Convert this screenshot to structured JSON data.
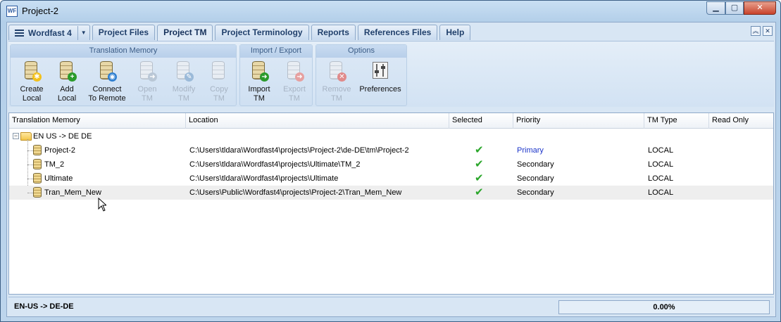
{
  "window": {
    "title": "Project-2",
    "app_icon": "WF"
  },
  "window_controls": {
    "minimize": "▁",
    "maximize": "▢",
    "close": "✕"
  },
  "tabs": [
    {
      "label": "Wordfast 4"
    },
    {
      "label": "Project Files"
    },
    {
      "label": "Project TM"
    },
    {
      "label": "Project Terminology"
    },
    {
      "label": "Reports"
    },
    {
      "label": "References Files"
    },
    {
      "label": "Help"
    }
  ],
  "active_tab": "Project TM",
  "ribbon": {
    "groups": [
      {
        "title": "Translation Memory",
        "buttons": [
          {
            "line1": "Create",
            "line2": "Local",
            "icon": "db-create-icon",
            "enabled": true
          },
          {
            "line1": "Add",
            "line2": "Local",
            "icon": "db-add-icon",
            "enabled": true
          },
          {
            "line1": "Connect",
            "line2": "To Remote",
            "icon": "db-connect-icon",
            "enabled": true
          },
          {
            "line1": "Open",
            "line2": "TM",
            "icon": "db-open-icon",
            "enabled": false
          },
          {
            "line1": "Modify",
            "line2": "TM",
            "icon": "db-modify-icon",
            "enabled": false
          },
          {
            "line1": "Copy",
            "line2": "TM",
            "icon": "db-copy-icon",
            "enabled": false
          }
        ]
      },
      {
        "title": "Import / Export",
        "buttons": [
          {
            "line1": "Import",
            "line2": "TM",
            "icon": "import-icon",
            "enabled": true
          },
          {
            "line1": "Export",
            "line2": "TM",
            "icon": "export-icon",
            "enabled": false
          }
        ]
      },
      {
        "title": "Options",
        "buttons": [
          {
            "line1": "Remove",
            "line2": "TM",
            "icon": "db-remove-icon",
            "enabled": false
          },
          {
            "line1": "Preferences",
            "line2": "",
            "icon": "preferences-icon",
            "enabled": true
          }
        ]
      }
    ]
  },
  "table": {
    "columns": [
      "Translation Memory",
      "Location",
      "Selected",
      "Priority",
      "TM Type",
      "Read Only"
    ],
    "group_label": "EN US -> DE DE",
    "rows": [
      {
        "name": "Project-2",
        "location": "C:\\Users\\tldara\\Wordfast4\\projects\\Project-2\\de-DE\\tm\\Project-2",
        "selected": true,
        "priority": "Primary",
        "type": "LOCAL",
        "read_only": ""
      },
      {
        "name": "TM_2",
        "location": "C:\\Users\\tldara\\Wordfast4\\projects\\Ultimate\\TM_2",
        "selected": true,
        "priority": "Secondary",
        "type": "LOCAL",
        "read_only": ""
      },
      {
        "name": "Ultimate",
        "location": "C:\\Users\\tldara\\Wordfast4\\projects\\Ultimate",
        "selected": true,
        "priority": "Secondary",
        "type": "LOCAL",
        "read_only": ""
      },
      {
        "name": "Tran_Mem_New",
        "location": "C:\\Users\\Public\\Wordfast4\\projects\\Project-2\\Tran_Mem_New",
        "selected": true,
        "priority": "Secondary",
        "type": "LOCAL",
        "read_only": ""
      }
    ],
    "check_glyph": "✔"
  },
  "status": {
    "language_pair": "EN-US -> DE-DE",
    "progress_text": "0.00%",
    "progress_value": 0
  },
  "colors": {
    "primary_priority": "#1a33c9",
    "check": "#2aa62a",
    "close_button": "#c8432c"
  }
}
